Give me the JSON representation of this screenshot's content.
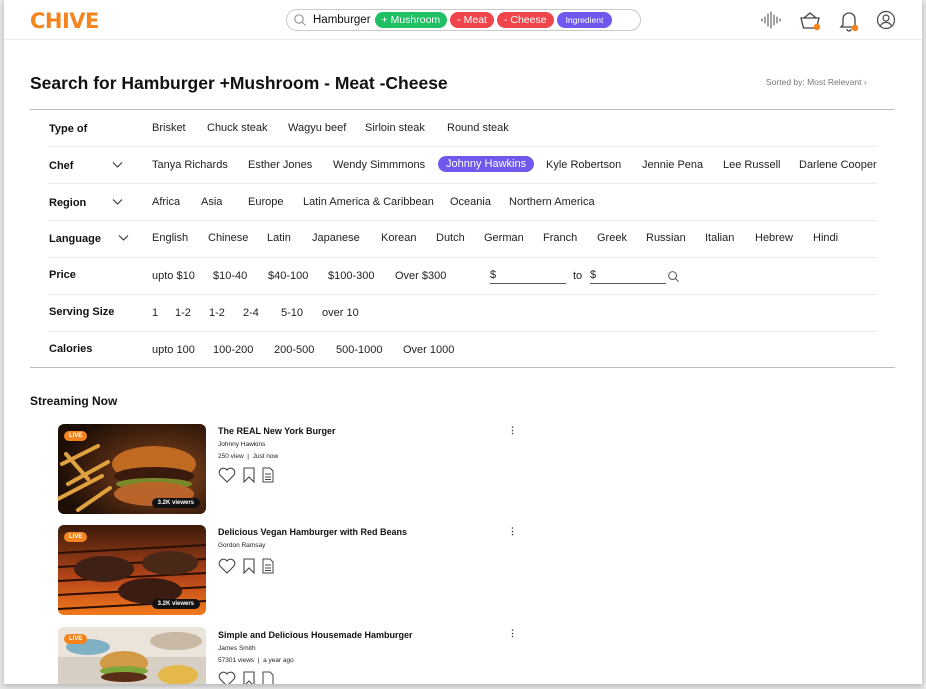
{
  "header": {
    "logo": "CHIVE",
    "search": {
      "query": "Hamburger",
      "chips": [
        {
          "label": "+ Mushroom",
          "color": "#1fbf63"
        },
        {
          "label": "- Meat",
          "color": "#f0464b"
        },
        {
          "label": "- Cheese",
          "color": "#f0464b"
        },
        {
          "label": "Ingredient",
          "color": "#6e58ee"
        }
      ]
    },
    "icons": [
      "voice-waveform-icon",
      "cooking-pot-icon",
      "bell-icon",
      "user-profile-icon"
    ],
    "notification_dot_color": "#f5841f"
  },
  "page": {
    "title": "Search for Hamburger +Mushroom - Meat -Cheese",
    "sorted_by": "Sorted by: Most Relevant"
  },
  "filters": {
    "type_of": {
      "label": "Type of",
      "options": [
        "Brisket",
        "Chuck steak",
        "Wagyu beef",
        "Sirloin steak",
        "Round steak"
      ]
    },
    "chef": {
      "label": "Chef",
      "options": [
        "Tanya Richards",
        "Esther Jones",
        "Wendy Simmmons",
        "Johnny Hawkins",
        "Kyle Robertson",
        "Jennie Pena",
        "Lee Russell",
        "Darlene Cooper"
      ],
      "selected": "Johnny Hawkins"
    },
    "region": {
      "label": "Region",
      "options": [
        "Africa",
        "Asia",
        "Europe",
        "Latin America & Caribbean",
        "Oceania",
        "Northern America"
      ]
    },
    "language": {
      "label": "Language",
      "options": [
        "English",
        "Chinese",
        "Latin",
        "Japanese",
        "Korean",
        "Dutch",
        "German",
        "Franch",
        "Greek",
        "Russian",
        "Italian",
        "Hebrew",
        "Hindi"
      ]
    },
    "price": {
      "label": "Price",
      "options": [
        "upto $10",
        "$10-40",
        "$40-100",
        "$100-300",
        "Over $300"
      ],
      "min_prefix": "$",
      "to": "to",
      "max_prefix": "$"
    },
    "serving": {
      "label": "Serving Size",
      "options": [
        "1",
        "1-2",
        "1-2",
        "2-4",
        "5-10",
        "over 10"
      ]
    },
    "calories": {
      "label": "Calories",
      "options": [
        "upto 100",
        "100-200",
        "200-500",
        "500-1000",
        "Over 1000"
      ]
    }
  },
  "streaming": {
    "title": "Streaming Now",
    "items": [
      {
        "live": "LIVE",
        "viewers": "3.2K viewers",
        "title": "The REAL New York Burger",
        "author": "Johnny Hawkins",
        "views": "250 view",
        "time": "Just now"
      },
      {
        "live": "LIVE",
        "viewers": "3.2K viewers",
        "title": "Delicious Vegan Hamburger with Red Beans",
        "author": "Gordon Ramsay"
      },
      {
        "live": "LIVE",
        "title": "Simple and Delicious Housemade Hamburger",
        "author": "James Smith",
        "views": "57301 views",
        "time": "a year ago"
      }
    ],
    "more": "⋮"
  },
  "colors": {
    "accent": "#f5841f",
    "selected_chip": "#6e58ee"
  }
}
